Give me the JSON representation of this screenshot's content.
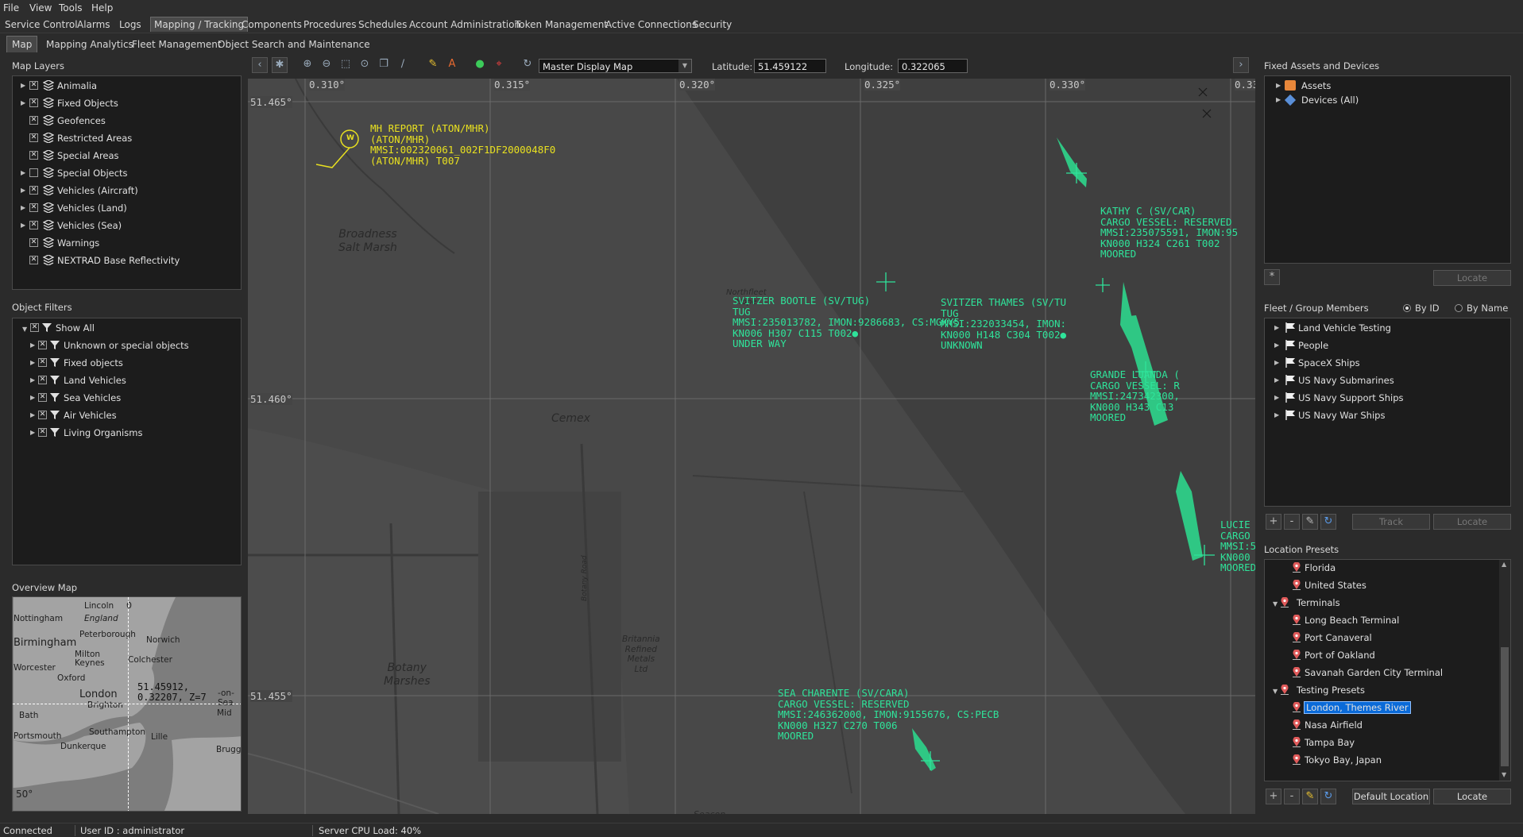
{
  "menubar": [
    "File",
    "View",
    "Tools",
    "Help"
  ],
  "nav_tabs": [
    "Service Control",
    "Alarms",
    "Logs",
    "Mapping / Tracking",
    "Components",
    "Procedures",
    "Schedules",
    "Account Administration",
    "Token Management",
    "Active Connections",
    "Security"
  ],
  "nav_active": "Mapping / Tracking",
  "sub_tabs": [
    "Map",
    "Mapping Analytics",
    "Fleet Management",
    "Object Search and Maintenance"
  ],
  "sub_active": "Map",
  "map_layers": {
    "title": "Map Layers",
    "items": [
      {
        "label": "Animalia",
        "expandable": true,
        "checked": true
      },
      {
        "label": "Fixed Objects",
        "expandable": true,
        "checked": true
      },
      {
        "label": "Geofences",
        "expandable": false,
        "checked": true
      },
      {
        "label": "Restricted Areas",
        "expandable": false,
        "checked": true
      },
      {
        "label": "Special Areas",
        "expandable": false,
        "checked": true
      },
      {
        "label": "Special Objects",
        "expandable": true,
        "checked": false
      },
      {
        "label": "Vehicles (Aircraft)",
        "expandable": true,
        "checked": true
      },
      {
        "label": "Vehicles (Land)",
        "expandable": true,
        "checked": true
      },
      {
        "label": "Vehicles (Sea)",
        "expandable": true,
        "checked": true
      },
      {
        "label": "Warnings",
        "expandable": false,
        "checked": true
      },
      {
        "label": "NEXTRAD Base Reflectivity",
        "expandable": false,
        "checked": true
      }
    ]
  },
  "object_filters": {
    "title": "Object Filters",
    "root": "Show All",
    "items": [
      "Unknown or special objects",
      "Fixed objects",
      "Land Vehicles",
      "Sea Vehicles",
      "Air Vehicles",
      "Living Organisms"
    ]
  },
  "overview": {
    "title": "Overview Map",
    "coords": "51.45912,\n0.32207, Z=7",
    "top_tick": "0",
    "bottom_tick": "50°",
    "places": [
      "Lincoln",
      "Nottingham",
      "England",
      "Birmingham",
      "Peterborough",
      "Norwich",
      "Milton",
      "Keynes",
      "Colchester",
      "Worcester",
      "Oxford",
      "London",
      "Bath",
      "Brighton",
      "Southampton",
      "Portsmouth",
      "Dunkerque",
      "Lille",
      "Brugg",
      "Mid",
      "-on-Sea"
    ]
  },
  "toolbar": {
    "map_select": "Master Display Map",
    "lat_label": "Latitude:",
    "lat_value": "51.459122",
    "lon_label": "Longitude:",
    "lon_value": "0.322065"
  },
  "map": {
    "lon_labels": [
      "0.310°",
      "0.315°",
      "0.320°",
      "0.325°",
      "0.330°",
      "0.33"
    ],
    "lat_labels": [
      "51.465°",
      "51.460°",
      "51.455°"
    ],
    "places": [
      "Broadness\nSalt Marsh",
      "Cemex",
      "Northfleet\nHope",
      "Botany\nMarshes",
      "Britannia\nRefined\nMetals\nLtd",
      "Seacon",
      "Botany Road"
    ],
    "aton_icon_letter": "W",
    "aton": "MH REPORT (ATON/MHR)\n(ATON/MHR)\nMMSI:002320061_002F1DF2000048F0\n(ATON/MHR) T007",
    "vessels": [
      {
        "name": "kathy",
        "text": "KATHY C (SV/CAR)\nCARGO VESSEL: RESERVED\nMMSI:235075591, IMON:95\nKN000 H324 C261 T002\nMOORED"
      },
      {
        "name": "bootle",
        "text": "SVITZER BOOTLE (SV/TUG)\nTUG\nMMSI:235013782, IMON:9286683, CS:MGKY5\nKN006 H307 C115 T002●\nUNDER WAY"
      },
      {
        "name": "thames",
        "text": "SVITZER THAMES (SV/TU\nTUG\nMMSI:232033454, IMON:\nKN000 H148 C304 T002●\nUNKNOWN"
      },
      {
        "name": "luanda",
        "text": "GRANDE LUANDA (\nCARGO VESSEL: R\nMMSI:247342300,\nKN000 H343 C13\nMOORED"
      },
      {
        "name": "lucie",
        "text": "LUCIE\nCARGO\nMMSI:5\nKN000\nMOORED"
      },
      {
        "name": "charente",
        "text": "SEA CHARENTE (SV/CARA)\nCARGO VESSEL: RESERVED\nMMSI:246362000, IMON:9155676, CS:PECB\nKN000 H327 C270 T006\nMOORED"
      }
    ]
  },
  "fixed_assets": {
    "title": "Fixed Assets and Devices",
    "items": [
      "Assets",
      "Devices (All)"
    ],
    "locate": "Locate",
    "small_btn": "*"
  },
  "fleet": {
    "title": "Fleet / Group Members",
    "by_id": "By ID",
    "by_name": "By Name",
    "items": [
      "Land Vehicle Testing",
      "People",
      "SpaceX Ships",
      "US Navy Submarines",
      "US Navy Support Ships",
      "US Navy War Ships"
    ],
    "track": "Track",
    "locate": "Locate"
  },
  "presets": {
    "title": "Location Presets",
    "rows": [
      {
        "label": "Florida",
        "level": 2
      },
      {
        "label": "United States",
        "level": 2
      },
      {
        "label": "Terminals",
        "level": 1
      },
      {
        "label": "Long Beach Terminal",
        "level": 2
      },
      {
        "label": "Port Canaveral",
        "level": 2
      },
      {
        "label": "Port of Oakland",
        "level": 2
      },
      {
        "label": "Savanah Garden City Terminal",
        "level": 2
      },
      {
        "label": "Testing Presets",
        "level": 1
      },
      {
        "label": "London, Themes River",
        "level": 2
      },
      {
        "label": "Nasa Airfield",
        "level": 2
      },
      {
        "label": "Tampa Bay",
        "level": 2
      },
      {
        "label": "Tokyo Bay, Japan",
        "level": 2
      }
    ],
    "selected": "London, Themes River",
    "default_btn": "Default Location",
    "locate": "Locate"
  },
  "status": {
    "connected": "Connected",
    "user": "User ID : administrator",
    "cpu": "Server CPU Load: 40%"
  },
  "colors": {
    "vessel": "#2fe39a",
    "aton": "#e8e020",
    "selection": "#0a6ad8"
  }
}
